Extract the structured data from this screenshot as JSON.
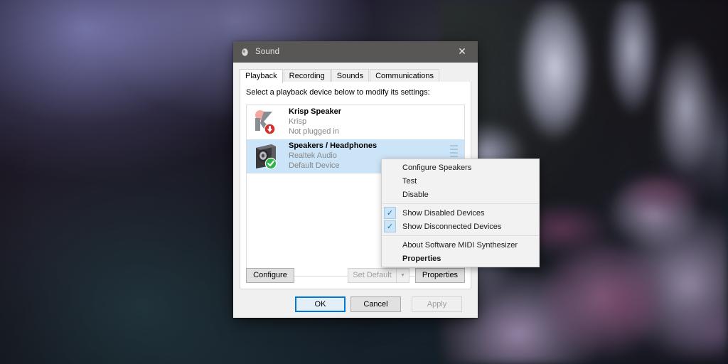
{
  "window": {
    "title": "Sound",
    "title_icon": "speaker-icon",
    "close_label": "✕"
  },
  "tabs": [
    {
      "label": "Playback",
      "active": true
    },
    {
      "label": "Recording",
      "active": false
    },
    {
      "label": "Sounds",
      "active": false
    },
    {
      "label": "Communications",
      "active": false
    }
  ],
  "panel": {
    "instruction": "Select a playback device below to modify its settings:"
  },
  "devices": [
    {
      "name": "Krisp Speaker",
      "vendor": "Krisp",
      "status": "Not plugged in",
      "icon": "krisp-logo-icon",
      "badge": "not-plugged-in-badge",
      "selected": false,
      "meter": false
    },
    {
      "name": "Speakers / Headphones",
      "vendor": "Realtek Audio",
      "status": "Default Device",
      "icon": "speaker-box-icon",
      "badge": "default-device-check-badge",
      "selected": true,
      "meter": true
    }
  ],
  "panel_buttons": {
    "configure": "Configure",
    "set_default": "Set Default",
    "set_default_arrow": "▼",
    "set_default_disabled": true,
    "properties": "Properties"
  },
  "footer_buttons": {
    "ok": "OK",
    "cancel": "Cancel",
    "apply": "Apply",
    "apply_disabled": true
  },
  "context_menu": {
    "items": [
      {
        "label": "Configure Speakers",
        "checked": false,
        "bold": false
      },
      {
        "label": "Test",
        "checked": false,
        "bold": false
      },
      {
        "label": "Disable",
        "checked": false,
        "bold": false
      },
      {
        "separator": true
      },
      {
        "label": "Show Disabled Devices",
        "checked": true,
        "bold": false
      },
      {
        "label": "Show Disconnected Devices",
        "checked": true,
        "bold": false
      },
      {
        "separator": true
      },
      {
        "label": "About Software MIDI Synthesizer",
        "checked": false,
        "bold": false
      },
      {
        "label": "Properties",
        "checked": false,
        "bold": true
      }
    ],
    "check_glyph": "✓"
  },
  "colors": {
    "titlebar": "#595755",
    "accent": "#0078d7",
    "selection": "#cce4f7",
    "dialog_bg": "#f0f0f0",
    "default_badge_green": "#2eb34a",
    "unplugged_badge_red": "#d32f2f"
  }
}
